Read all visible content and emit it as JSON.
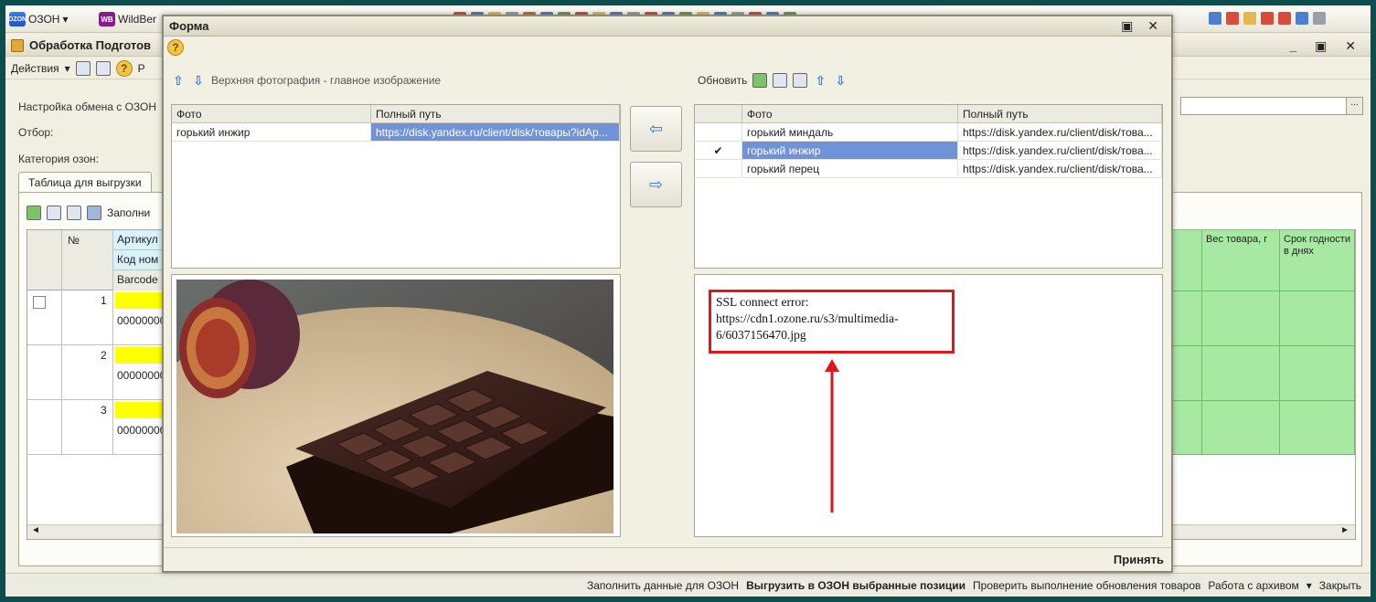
{
  "topbar": {
    "ozon_label": "ОЗОН",
    "ozon_badge": "OZON",
    "wb_badge": "WB",
    "wb_label": "WildBer"
  },
  "bg_window": {
    "title": "Обработка  Подготов",
    "actions_label": "Действия",
    "help_glyph": "?",
    "help_extra": "Р",
    "exchange_label": "Настройка обмена с ОЗОН",
    "filter_label": "Отбор:",
    "category_label": "Категория озон:",
    "tab_label": "Таблица для выгрузки",
    "fill_label": "Заполни",
    "grid": {
      "col_num": "№",
      "col_article": "Артикул",
      "col_code": "Код ном",
      "col_barcode": "Barcode",
      "col_weight": "Вес товара, г",
      "col_shelf": "Срок годности в днях",
      "rows": [
        {
          "num": "1",
          "barcode": "00000000"
        },
        {
          "num": "2",
          "barcode": "00000000"
        },
        {
          "num": "3",
          "barcode": "00000000"
        }
      ]
    },
    "bottom": {
      "fill": "Заполнить данные для ОЗОН",
      "upload": "Выгрузить в ОЗОН выбранные позиции",
      "check": "Проверить выполнение обновления товаров",
      "archive": "Работа с архивом",
      "close": "Закрыть"
    }
  },
  "modal": {
    "title": "Форма",
    "help_glyph": "?",
    "left_caption": "Верхняя фотография - главное изображение",
    "right_refresh": "Обновить",
    "left_table": {
      "headers": [
        "Фото",
        "Полный путь"
      ],
      "rows": [
        {
          "photo": "горький инжир",
          "path": "https://disk.yandex.ru/client/disk/товары?idAp..."
        }
      ]
    },
    "right_table": {
      "headers": [
        "",
        "Фото",
        "Полный путь"
      ],
      "rows": [
        {
          "check": "",
          "photo": "горький миндаль",
          "path": "https://disk.yandex.ru/client/disk/това..."
        },
        {
          "check": "✔",
          "photo": "горький инжир",
          "path": "https://disk.yandex.ru/client/disk/това..."
        },
        {
          "check": "",
          "photo": "горький перец",
          "path": "https://disk.yandex.ru/client/disk/това..."
        }
      ]
    },
    "error_text": "SSL connect error: https://cdn1.ozone.ru/s3/multimedia-6/6037156470.jpg",
    "accept_label": "Принять",
    "window_buttons": "▣ ✕"
  }
}
